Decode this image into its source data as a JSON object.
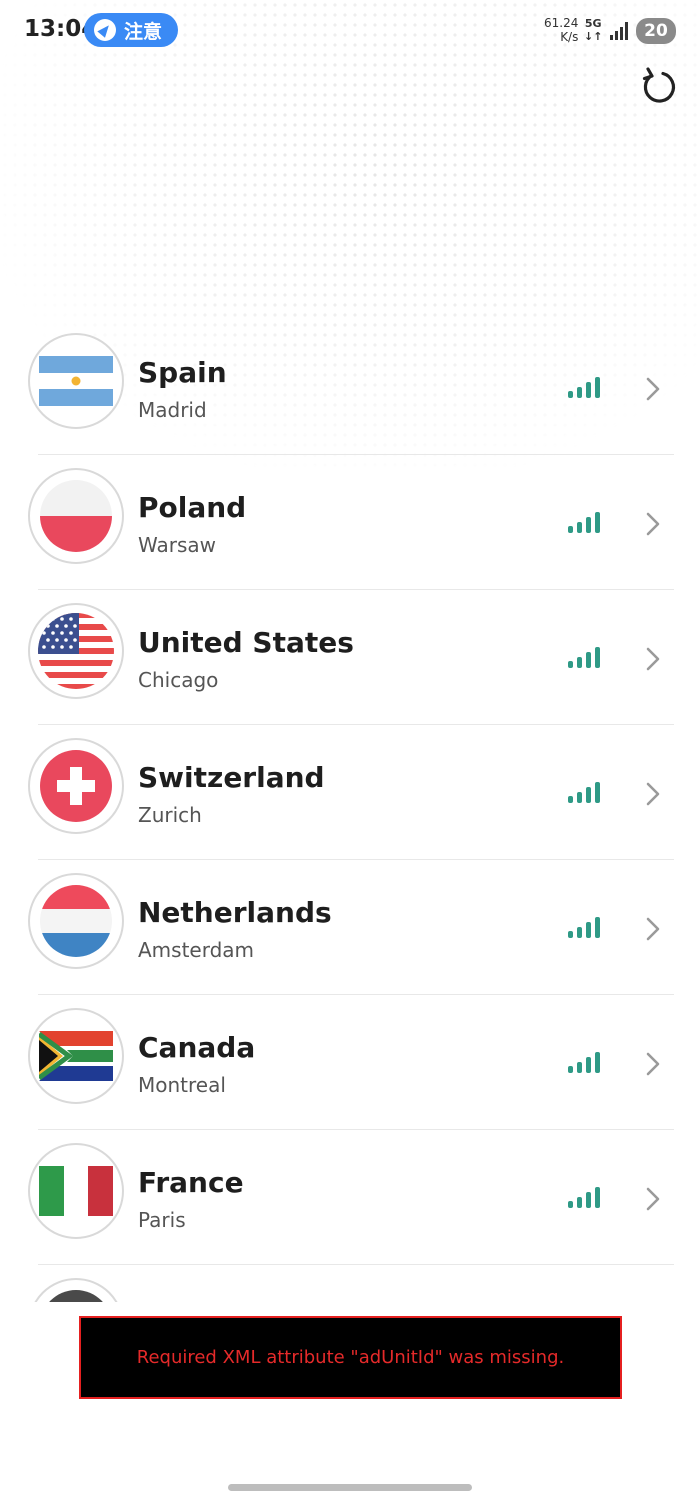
{
  "status_bar": {
    "time": "13:04",
    "notice_label": "注意",
    "net_speed_value": "61.24",
    "net_speed_unit": "K/s",
    "net_type": "5G",
    "battery": "20"
  },
  "icons": {
    "refresh": "refresh-icon",
    "signal": "signal-strength-icon",
    "chevron": "chevron-right-icon"
  },
  "colors": {
    "accent_blue": "#3a8af5",
    "signal_teal": "#2f9a86",
    "error_red": "#e52a2a"
  },
  "servers": [
    {
      "country": "Spain",
      "city": "Madrid"
    },
    {
      "country": "Poland",
      "city": "Warsaw"
    },
    {
      "country": "United States",
      "city": "Chicago"
    },
    {
      "country": "Switzerland",
      "city": "Zurich"
    },
    {
      "country": "Netherlands",
      "city": "Amsterdam"
    },
    {
      "country": "Canada",
      "city": "Montreal"
    },
    {
      "country": "France",
      "city": "Paris"
    }
  ],
  "ad_error": {
    "message": "Required XML attribute \"adUnitId\" was missing."
  }
}
